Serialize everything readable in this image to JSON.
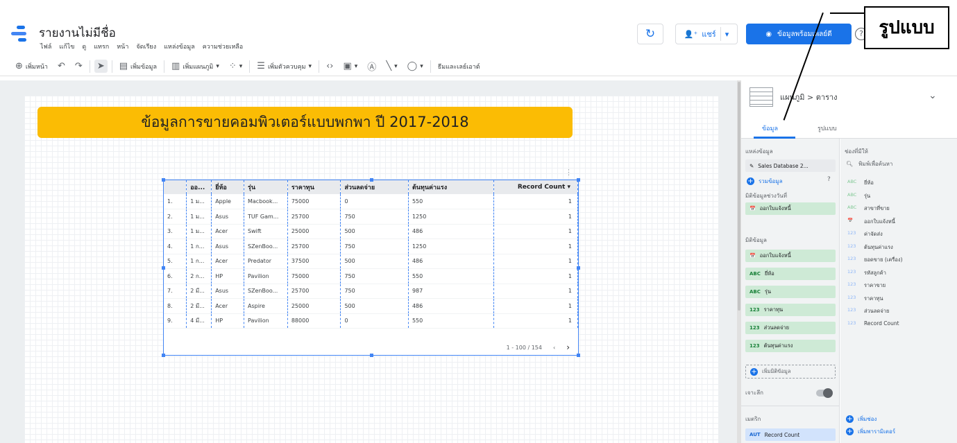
{
  "header": {
    "title": "รายงานไม่มีชื่อ",
    "menu": [
      "ไฟล์",
      "แก้ไข",
      "ดู",
      "แทรก",
      "หน้า",
      "จัดเรียง",
      "แหล่งข้อมูล",
      "ความช่วยเหลือ"
    ],
    "refresh_icon": "↻",
    "share_label": "แชร์",
    "view_label": "ข้อมูลพร้อมเพลย์ดี",
    "help_icon": "?"
  },
  "callout": "รูปแบบ",
  "toolbar": {
    "add_page": "เพิ่มหน้า",
    "add_data": "เพิ่มข้อมูล",
    "add_chart": "เพิ่มแผนภูมิ",
    "add_control": "เพิ่มตัวควบคุม",
    "theme_layout": "ธีมและเลย์เอาต์"
  },
  "report": {
    "banner": "ข้อมูลการขายคอมพิวเตอร์แบบพกพา ปี 2017-2018",
    "table": {
      "headers": [
        "ออ...",
        "ยี่ห้อ",
        "รุ่น",
        "ราคาทุน",
        "ส่วนลดจ่าย",
        "ต้นทุนค่าแรง",
        "Record Count"
      ],
      "rows": [
        [
          "1.",
          "1 ม...",
          "Apple",
          "Macbook...",
          "75000",
          "0",
          "550",
          "1"
        ],
        [
          "2.",
          "1 ม...",
          "Asus",
          "TUF Gam...",
          "25700",
          "750",
          "1250",
          "1"
        ],
        [
          "3.",
          "1 ม...",
          "Acer",
          "Swift",
          "25000",
          "500",
          "486",
          "1"
        ],
        [
          "4.",
          "1 ก...",
          "Asus",
          "SZenBoo...",
          "25700",
          "750",
          "1250",
          "1"
        ],
        [
          "5.",
          "1 ก...",
          "Acer",
          "Predator",
          "37500",
          "500",
          "486",
          "1"
        ],
        [
          "6.",
          "2 ก...",
          "HP",
          "Pavilion",
          "75000",
          "750",
          "550",
          "1"
        ],
        [
          "7.",
          "2 มี...",
          "Asus",
          "SZenBoo...",
          "25700",
          "750",
          "987",
          "1"
        ],
        [
          "8.",
          "2 มี...",
          "Acer",
          "Aspire",
          "25000",
          "500",
          "486",
          "1"
        ],
        [
          "9.",
          "4 มี...",
          "HP",
          "Pavilion",
          "88000",
          "0",
          "550",
          "1"
        ]
      ],
      "pager": "1 - 100 / 154"
    }
  },
  "panel": {
    "chart_type": "แผนภูมิ > ตาราง",
    "tab_data": "ข้อมูล",
    "tab_style": "รูปแบบ",
    "data_source_label": "แหล่งข้อมูล",
    "data_source": "Sales Database 2...",
    "blend_label": "รวมข้อมูล",
    "date_range_label": "มิติข้อมูลช่วงวันที่",
    "date_range_value": "ออกใบแจ้งหนี้",
    "dimension_label": "มิติข้อมูล",
    "dimensions": [
      {
        "type": "📅",
        "name": "ออกใบแจ้งหนี้"
      },
      {
        "type": "ABC",
        "name": "ยี่ห้อ"
      },
      {
        "type": "ABC",
        "name": "รุ่น"
      },
      {
        "type": "123",
        "name": "ราคาทุน"
      },
      {
        "type": "123",
        "name": "ส่วนลดจ่าย"
      },
      {
        "type": "123",
        "name": "ต้นทุนค่าแรง"
      }
    ],
    "add_dimension": "เพิ่มมิติข้อมูล",
    "drilldown_label": "เจาะลึก",
    "metric_label": "เมตริก",
    "metric_value": "Record Count",
    "metric_type": "AUT",
    "available_label": "ช่องที่มีให้",
    "search_placeholder": "พิมพ์เพื่อค้นหา",
    "fields": [
      {
        "type": "ABC",
        "name": "ยี่ห้อ"
      },
      {
        "type": "ABC",
        "name": "รุ่น"
      },
      {
        "type": "ABC",
        "name": "สาขาที่ขาย"
      },
      {
        "type": "📅",
        "name": "ออกใบแจ้งหนี้"
      },
      {
        "type": "123",
        "name": "ค่าจัดส่ง"
      },
      {
        "type": "123",
        "name": "ต้นทุนค่าแรง"
      },
      {
        "type": "123",
        "name": "ยอดขาย (เครื่อง)"
      },
      {
        "type": "123",
        "name": "รหัสลูกค้า"
      },
      {
        "type": "123",
        "name": "ราคาขาย"
      },
      {
        "type": "123",
        "name": "ราคาทุน"
      },
      {
        "type": "123",
        "name": "ส่วนลดจ่าย"
      },
      {
        "type": "123",
        "name": "Record Count"
      }
    ],
    "add_field": "เพิ่มช่อง",
    "add_param": "เพิ่มพารามิเตอร์"
  }
}
